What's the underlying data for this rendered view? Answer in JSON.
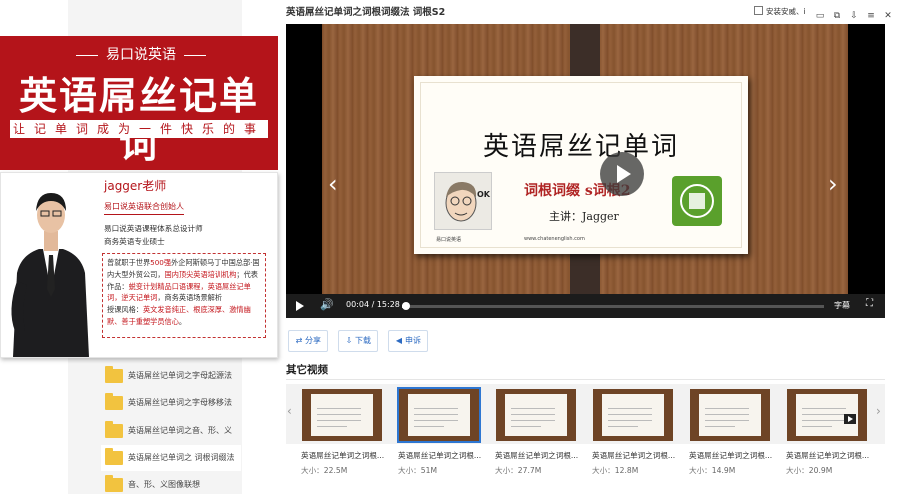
{
  "banner": {
    "brand": "易口说英语",
    "title": "英语屌丝记单词",
    "slogan": "让记单词成为一件快乐的事"
  },
  "teacher": {
    "name": "jagger老师",
    "role": "易口说英语联合创始人",
    "lines": [
      "易口说英语课程体系总设计师",
      "商务英语专业硕士"
    ],
    "bio": {
      "p1": "曾就职于世界",
      "p1_hl": "500强",
      "p2": "外企阿斯顿马丁中国总部·国内大型外贸公司，",
      "p2_hl": "国内顶尖英语培训机构",
      "p3": "；代表作品：",
      "p3_hl": "蜕变计划精品口语课程，英语屌丝记单词，逆天记单词",
      "p4": "，商务英语场景解析",
      "p5": "授课风格：",
      "p5_hl": "英文发音纯正、根底深厚、激情幽默、善于重塑学员信心",
      "p6": "。"
    }
  },
  "file_list": [
    {
      "label": "英语屌丝记单词之字母起源法",
      "active": false
    },
    {
      "label": "英语屌丝记单词之字母移移法",
      "active": false
    },
    {
      "label": "英语屌丝记单词之音、形、义",
      "active": false
    },
    {
      "label": "英语屌丝记单词之 词根词缀法",
      "active": true
    },
    {
      "label": "音、形、义图像联想",
      "active": false
    }
  ],
  "player": {
    "video_title": "英语屌丝记单词之词根词缀法 词根S2",
    "checkbox_label": "安装安威、i",
    "current_time": "00:04",
    "total_time": "15:28",
    "progress_fraction": 0.0043,
    "subtitle_label": "字幕",
    "card": {
      "title": "英语屌丝记单词",
      "subtitle": "词根词缀 s词根2",
      "speaker": "主讲：Jagger",
      "footer_left": "易口说英语",
      "footer_url": "www.chatenenglish.com"
    }
  },
  "actions": {
    "share": "分享",
    "download": "下载",
    "report": "申诉"
  },
  "other_videos": {
    "heading": "其它视频",
    "size_prefix": "大小：",
    "items": [
      {
        "title": "英语屌丝记单词之词根...",
        "size": "22.5M",
        "selected": false
      },
      {
        "title": "英语屌丝记单词之词根...",
        "size": "51M",
        "selected": true
      },
      {
        "title": "英语屌丝记单词之词根...",
        "size": "27.7M",
        "selected": false
      },
      {
        "title": "英语屌丝记单词之词根...",
        "size": "12.8M",
        "selected": false
      },
      {
        "title": "英语屌丝记单词之词根...",
        "size": "14.9M",
        "selected": false
      },
      {
        "title": "英语屌丝记单词之词根...",
        "size": "20.9M",
        "selected": false
      }
    ]
  },
  "colors": {
    "brand_red": "#b4141a",
    "link_blue": "#2d6bc2",
    "folder_yellow": "#f2c33f"
  }
}
